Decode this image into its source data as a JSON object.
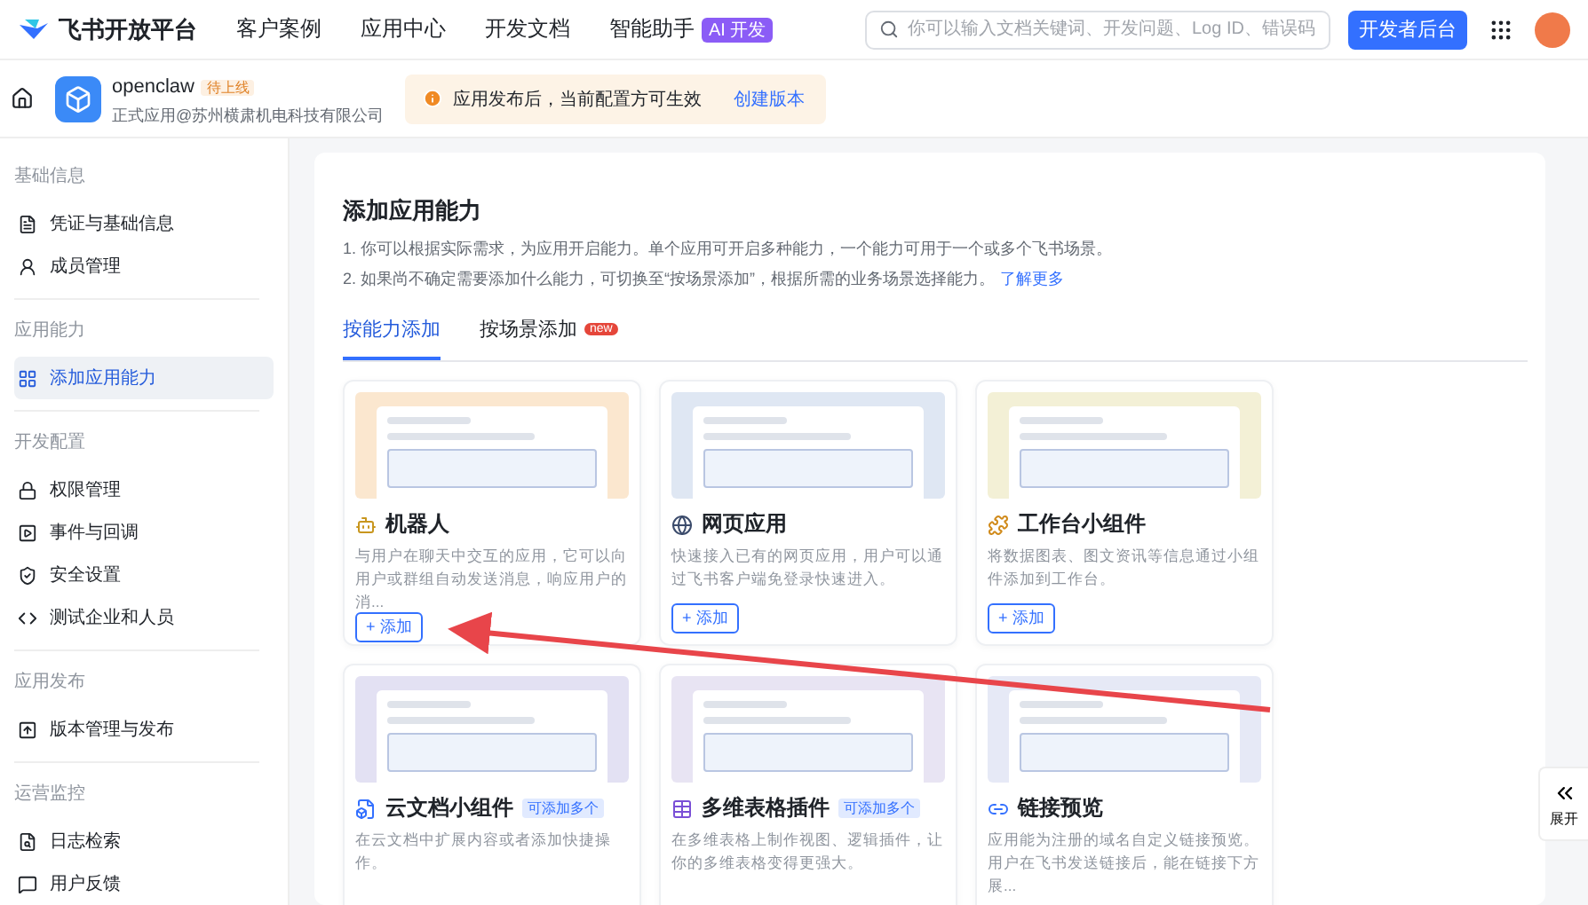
{
  "topbar": {
    "brand": "飞书开放平台",
    "nav": [
      {
        "label": "客户案例"
      },
      {
        "label": "应用中心"
      },
      {
        "label": "开发文档"
      },
      {
        "label": "智能助手",
        "badge": "AI 开发"
      }
    ],
    "search": {
      "placeholder": "你可以输入文档关键词、开发问题、Log ID、错误码"
    },
    "console_button": "开发者后台"
  },
  "app_bar": {
    "app_name": "openclaw",
    "status": "待上线",
    "owner": "正式应用@苏州横肃机电科技有限公司",
    "notice": "应用发布后，当前配置方可生效",
    "notice_link": "创建版本"
  },
  "sidebar": {
    "groups": [
      {
        "title": "基础信息",
        "items": [
          {
            "label": "凭证与基础信息",
            "selected": false
          },
          {
            "label": "成员管理",
            "selected": false
          }
        ]
      },
      {
        "title": "应用能力",
        "items": [
          {
            "label": "添加应用能力",
            "selected": true
          }
        ]
      },
      {
        "title": "开发配置",
        "items": [
          {
            "label": "权限管理",
            "selected": false
          },
          {
            "label": "事件与回调",
            "selected": false
          },
          {
            "label": "安全设置",
            "selected": false
          },
          {
            "label": "测试企业和人员",
            "selected": false
          }
        ]
      },
      {
        "title": "应用发布",
        "items": [
          {
            "label": "版本管理与发布",
            "selected": false
          }
        ]
      },
      {
        "title": "运营监控",
        "items": [
          {
            "label": "日志检索",
            "selected": false
          },
          {
            "label": "用户反馈",
            "selected": false
          }
        ]
      }
    ]
  },
  "main": {
    "title": "添加应用能力",
    "notes": [
      "1. 你可以根据实际需求，为应用开启能力。单个应用可开启多种能力，一个能力可用于一个或多个飞书场景。",
      "2. 如果尚不确定需要添加什么能力，可切换至“按场景添加”，根据所需的业务场景选择能力。"
    ],
    "learn_more": "了解更多",
    "tabs": [
      {
        "label": "按能力添加",
        "selected": true
      },
      {
        "label": "按场景添加",
        "selected": false,
        "badge": "new"
      }
    ],
    "cards": [
      {
        "title": "机器人",
        "description": "与用户在聊天中交互的应用，它可以向用户或群组自动发送消息，响应用户的消...",
        "add_button": "+ 添加",
        "color": "#fbe7cf"
      },
      {
        "title": "网页应用",
        "description": "快速接入已有的网页应用，用户可以通过飞书客户端免登录快速进入。",
        "add_button": "+ 添加",
        "color": "#dfe7f3"
      },
      {
        "title": "工作台小组件",
        "description": "将数据图表、图文资讯等信息通过小组件添加到工作台。",
        "add_button": "+ 添加",
        "color": "#f3f0d6"
      },
      {
        "title": "云文档小组件",
        "badge": "可添加多个",
        "description": "在云文档中扩展内容或者添加快捷操作。",
        "color": "#e3e1f3"
      },
      {
        "title": "多维表格插件",
        "badge": "可添加多个",
        "description": "在多维表格上制作视图、逻辑插件，让你的多维表格变得更强大。",
        "color": "#e8e4f3"
      },
      {
        "title": "链接预览",
        "description": "应用能为注册的域名自定义链接预览。用户在飞书发送链接后，能在链接下方展...",
        "color": "#e6e9f6"
      }
    ]
  },
  "expand_button": "展开"
}
